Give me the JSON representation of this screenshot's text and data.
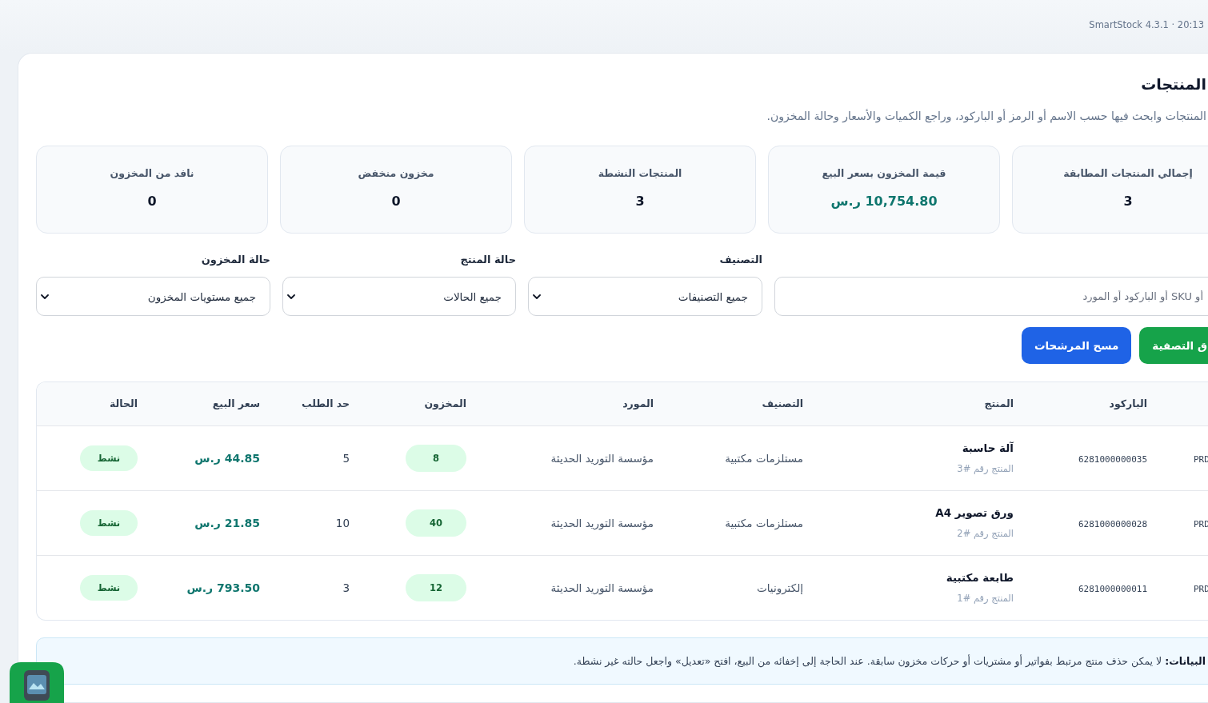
{
  "topbar": {
    "version": "SmartStock 4.3.1 · 20:13"
  },
  "page": {
    "title": "المنتجات",
    "subtitle": "المنتجات وابحث فيها حسب الاسم أو الرمز أو الباركود، وراجع الكميات والأسعار وحالة المخزون."
  },
  "stats": [
    {
      "label": "إجمالي المنتجات المطابقة",
      "value": "3",
      "kind": "count"
    },
    {
      "label": "قيمة المخزون بسعر البيع",
      "value": "10,754.80 ر.س",
      "kind": "money"
    },
    {
      "label": "المنتجات النشطة",
      "value": "3",
      "kind": "count"
    },
    {
      "label": "مخزون منخفض",
      "value": "0",
      "kind": "count"
    },
    {
      "label": "نافد من المخزون",
      "value": "0",
      "kind": "count"
    }
  ],
  "filters": {
    "search": {
      "placeholder": "أو SKU أو الباركود أو المورد"
    },
    "selects": [
      {
        "label": "التصنيف",
        "value": "جميع التصنيفات"
      },
      {
        "label": "حالة المنتج",
        "value": "جميع الحالات"
      },
      {
        "label": "حالة المخزون",
        "value": "جميع مستويات المخزون"
      }
    ]
  },
  "buttons": [
    {
      "label": "ق التصفية",
      "kind": "apply"
    },
    {
      "label": "مسح المرشحات",
      "kind": "clear"
    }
  ],
  "table": {
    "columns": [
      "الباركود",
      "المنتج",
      "التصنيف",
      "المورد",
      "المخزون",
      "حد الطلب",
      "سعر البيع",
      "الحالة"
    ],
    "rows": [
      {
        "column_1": "PRD",
        "barcode": "6281000000035",
        "product": "آلة حاسبة",
        "product_number": "المنتج رقم #3",
        "category": "مستلزمات مكتبية",
        "supplier": "مؤسسة التوريد الحديثة",
        "stock": "8",
        "reorder_level": "5",
        "price": "44.85 ر.س",
        "status": "نشط"
      },
      {
        "column_1": "PRD",
        "barcode": "6281000000028",
        "product": "ورق تصوير A4",
        "product_number": "المنتج رقم #2",
        "category": "مستلزمات مكتبية",
        "supplier": "مؤسسة التوريد الحديثة",
        "stock": "40",
        "reorder_level": "10",
        "price": "21.85 ر.س",
        "status": "نشط"
      },
      {
        "column_1": "PRD",
        "barcode": "6281000000011",
        "product": "طابعة مكتبية",
        "product_number": "المنتج رقم #1",
        "category": "إلكترونيات",
        "supplier": "مؤسسة التوريد الحديثة",
        "stock": "12",
        "reorder_level": "3",
        "price": "793.50 ر.س",
        "status": "نشط"
      }
    ]
  },
  "note": {
    "text": "**البيانات:** لا يمكن حذف منتج مرتبط بفواتير أو مشتريات أو حركات مخزون سابقة. عند الحاجة إلى إخفائه من البيع، افتح «تعديل» واجعل حالته غير نشطة."
  }
}
